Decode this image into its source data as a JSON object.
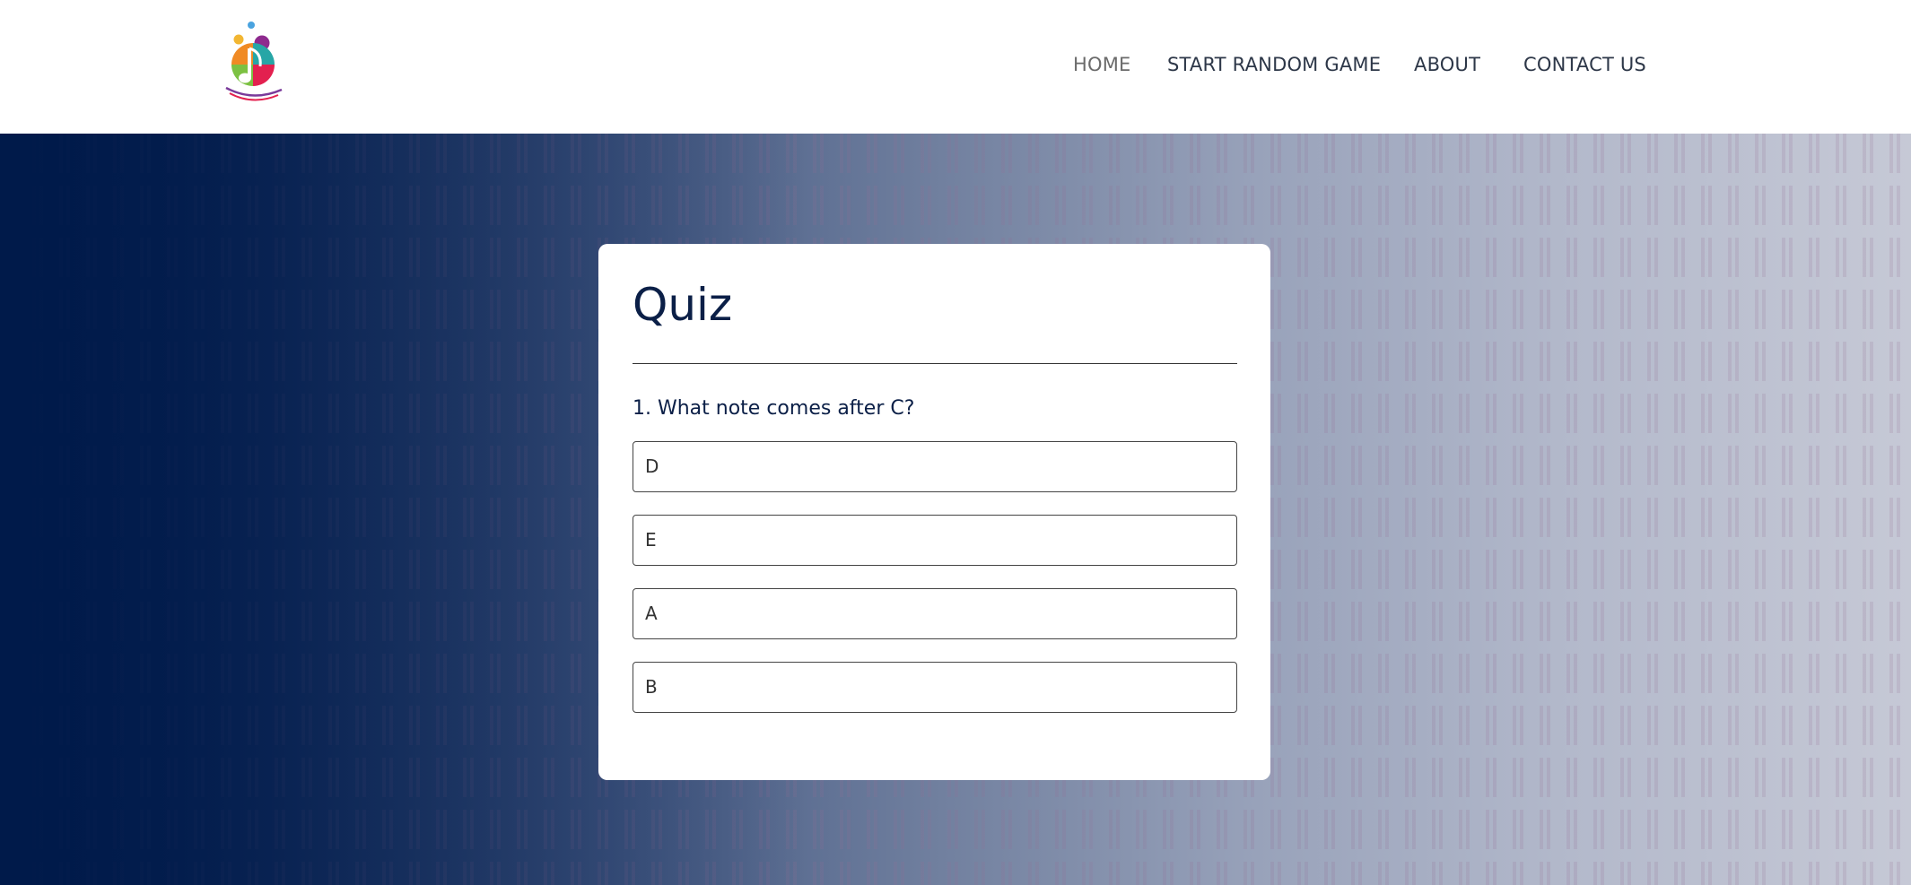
{
  "header": {
    "logo_icon": "colorful-music-note-logo",
    "nav": [
      {
        "label": "HOME",
        "active": true
      },
      {
        "label": "START RANDOM GAME",
        "active": false
      },
      {
        "label": "ABOUT",
        "active": false
      },
      {
        "label": "CONTACT US",
        "active": false
      }
    ]
  },
  "quiz": {
    "title": "Quiz",
    "question": "1. What note comes after C?",
    "answers": [
      "D",
      "E",
      "A",
      "B"
    ]
  },
  "colors": {
    "brand_navy": "#0b1f47",
    "hero_dark": "#001a4a",
    "hero_light": "#c6c9d6"
  }
}
